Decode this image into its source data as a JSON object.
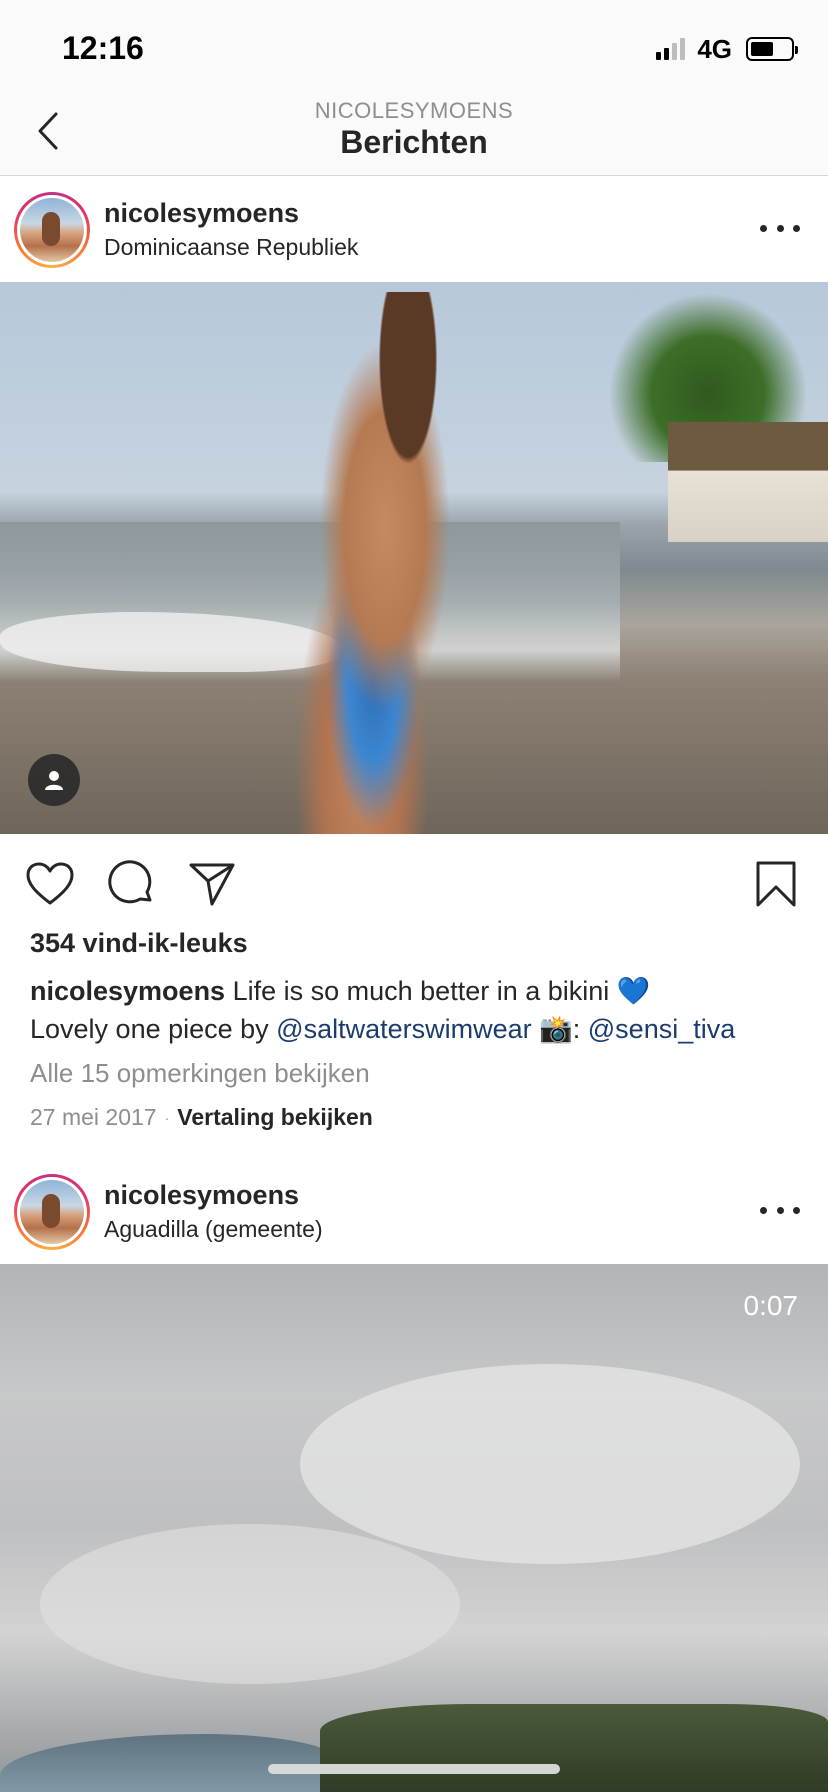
{
  "status_bar": {
    "time": "12:16",
    "network": "4G",
    "signal_bars": 2,
    "battery_level": 0.55
  },
  "nav": {
    "subtitle": "NICOLESYMOENS",
    "title": "Berichten",
    "back_icon": "chevron-left-icon"
  },
  "posts": [
    {
      "username": "nicolesymoens",
      "location": "Dominicaanse Republiek",
      "likes": "354 vind-ik-leuks",
      "caption_user": "nicolesymoens",
      "caption_text_1": " Life is so much better in a bikini 💙",
      "caption_text_2": "Lovely one piece by ",
      "mention_1": "@saltwaterswimwear",
      "caption_text_3": " 📸: ",
      "mention_2": "@sensi_tiva",
      "comments_link": "Alle 15 opmerkingen bekijken",
      "date": "27 mei 2017",
      "separator": "·",
      "translate": "Vertaling bekijken"
    },
    {
      "username": "nicolesymoens",
      "location": "Aguadilla (gemeente)",
      "video_duration": "0:07"
    }
  ],
  "icons": {
    "like": "heart-icon",
    "comment": "comment-icon",
    "share": "paper-plane-icon",
    "save": "bookmark-icon",
    "more": "more-dots-icon",
    "tag": "user-tag-icon"
  },
  "colors": {
    "text": "#262626",
    "secondary": "#8e8e8e",
    "mention": "#1c3c6e",
    "background": "#ffffff",
    "bar": "#fafafa"
  }
}
